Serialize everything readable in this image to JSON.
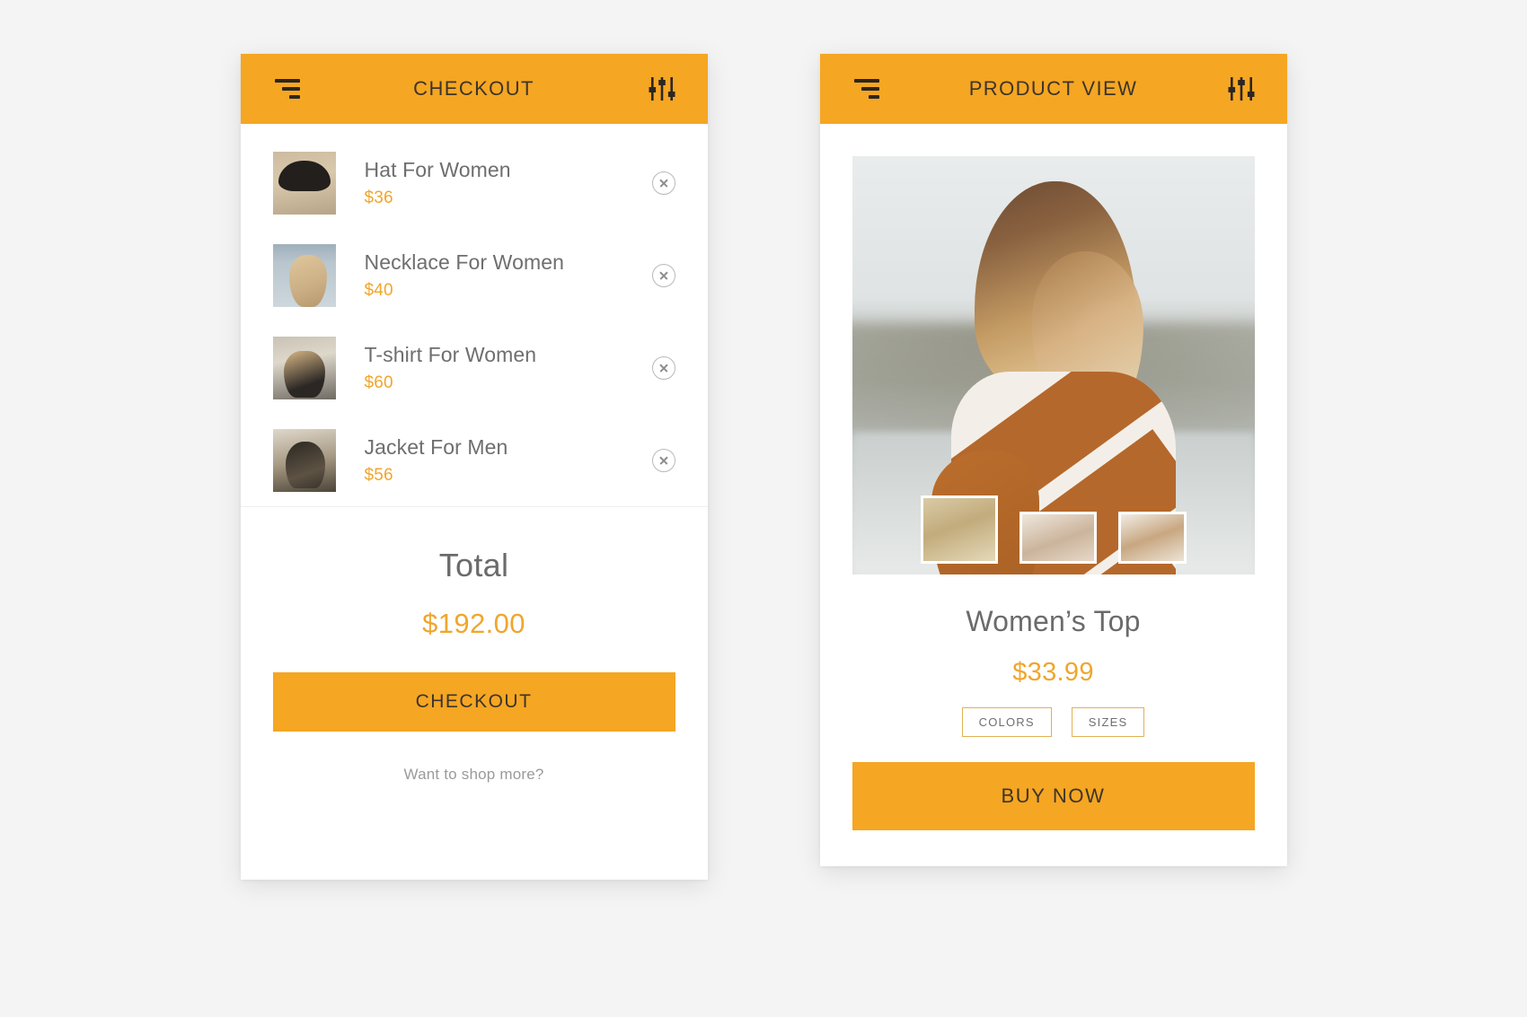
{
  "accent_color": "#f5a623",
  "price_color": "#f0a62c",
  "text_color": "#6e6e6e",
  "checkout_screen": {
    "header": {
      "title": "CHECKOUT",
      "menu_icon": "hamburger-icon",
      "filter_icon": "sliders-filter-icon"
    },
    "cart_items": [
      {
        "name": "Hat For Women",
        "price": "$36",
        "thumb": "t-hat",
        "remove_icon": "close-circle-icon"
      },
      {
        "name": "Necklace For Women",
        "price": "$40",
        "thumb": "t-neck",
        "remove_icon": "close-circle-icon"
      },
      {
        "name": "T-shirt For Women",
        "price": "$60",
        "thumb": "t-tshirt",
        "remove_icon": "close-circle-icon"
      },
      {
        "name": "Jacket For Men",
        "price": "$56",
        "thumb": "t-jacket",
        "remove_icon": "close-circle-icon"
      }
    ],
    "totals": {
      "label": "Total",
      "amount": "$192.00"
    },
    "checkout_button": "CHECKOUT",
    "shop_more_link": "Want to shop more?"
  },
  "product_screen": {
    "header": {
      "title": "PRODUCT VIEW",
      "menu_icon": "hamburger-icon",
      "filter_icon": "sliders-filter-icon"
    },
    "hero": {
      "alt": "woman-in-chevron-sweater-photo",
      "gallery": [
        {
          "alt": "thumbnail-woman-field-photo"
        },
        {
          "alt": "thumbnail-woman-blush-top-photo"
        },
        {
          "alt": "thumbnail-woman-side-profile-photo"
        }
      ]
    },
    "product": {
      "title": "Women’s Top",
      "price": "$33.99",
      "options": [
        {
          "label": "COLORS"
        },
        {
          "label": "SIZES"
        }
      ]
    },
    "buy_button": "BUY NOW"
  }
}
